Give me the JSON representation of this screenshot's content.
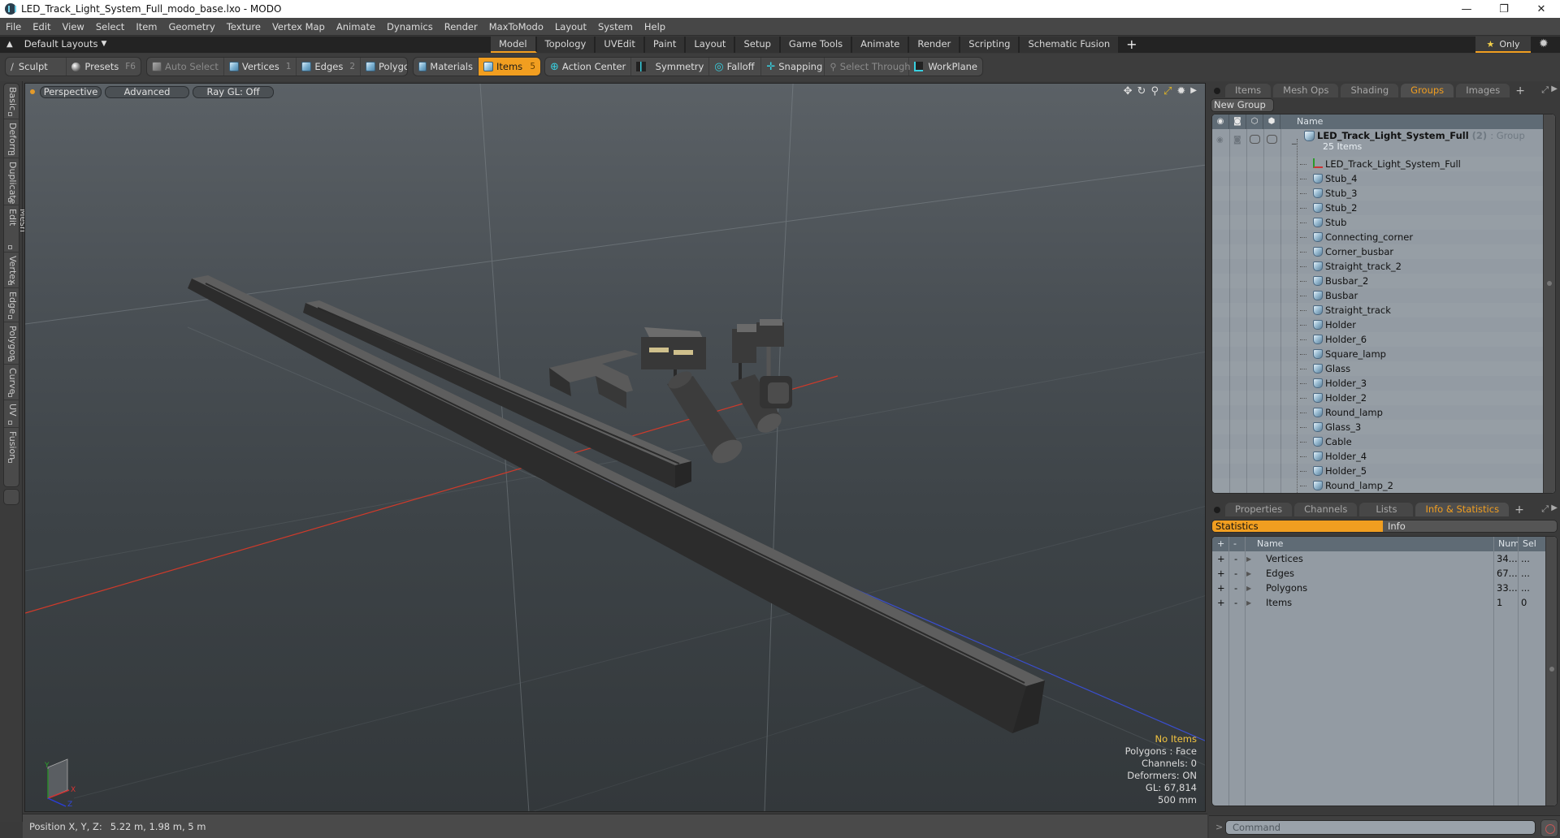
{
  "window": {
    "title": "LED_Track_Light_System_Full_modo_base.lxo - MODO",
    "controls": {
      "minimize": "—",
      "maximize": "❐",
      "close": "✕"
    }
  },
  "menu": [
    "File",
    "Edit",
    "View",
    "Select",
    "Item",
    "Geometry",
    "Texture",
    "Vertex Map",
    "Animate",
    "Dynamics",
    "Render",
    "MaxToModo",
    "Layout",
    "System",
    "Help"
  ],
  "layoutbar": {
    "layout_select": "Default Layouts",
    "tabs": [
      {
        "label": "Model",
        "active": true
      },
      {
        "label": "Topology"
      },
      {
        "label": "UVEdit"
      },
      {
        "label": "Paint"
      },
      {
        "label": "Layout"
      },
      {
        "label": "Setup"
      },
      {
        "label": "Game Tools"
      },
      {
        "label": "Animate"
      },
      {
        "label": "Render"
      },
      {
        "label": "Scripting"
      },
      {
        "label": "Schematic Fusion"
      }
    ],
    "add_tab": "+",
    "only_label": "Only"
  },
  "toolbar": {
    "sculpt": "Sculpt",
    "presets": "Presets",
    "presets_key": "F6",
    "auto_select": "Auto Select",
    "vertices": "Vertices",
    "vertices_key": "1",
    "edges": "Edges",
    "edges_key": "2",
    "polygons": "Polygons",
    "materials": "Materials",
    "items": "Items",
    "items_key": "5",
    "action_center": "Action Center",
    "symmetry": "Symmetry",
    "falloff": "Falloff",
    "snapping": "Snapping",
    "select_through": "Select Through",
    "workplane": "WorkPlane"
  },
  "left_tabs": [
    "Basic",
    "Deform",
    "Duplicate",
    "Mesh Edit",
    "Vertex",
    "Edge",
    "Polygon",
    "Curve",
    "UV",
    "Fusion"
  ],
  "viewport": {
    "view_mode": "Perspective",
    "shading": "Advanced",
    "raygl": "Ray GL: Off",
    "info": {
      "selection": "No Items",
      "polygons": "Polygons : Face",
      "channels": "Channels: 0",
      "deformers": "Deformers: ON",
      "gl": "GL: 67,814",
      "scale": "500 mm"
    },
    "axis_labels": {
      "x": "X",
      "y": "Y",
      "z": "Z"
    }
  },
  "status": {
    "position_label": "Position X, Y, Z:",
    "position_value": "5.22 m, 1.98 m, 5 m"
  },
  "groups_panel": {
    "tabs": [
      {
        "label": "Items"
      },
      {
        "label": "Mesh Ops"
      },
      {
        "label": "Shading"
      },
      {
        "label": "Groups",
        "active": true
      },
      {
        "label": "Images"
      }
    ],
    "new_group": "New Group",
    "column_name": "Name",
    "group": {
      "name": "LED_Track_Light_System_Full",
      "count": "(2)",
      "type": ": Group",
      "items_count": "25 Items"
    },
    "children": [
      {
        "name": "LED_Track_Light_System_Full",
        "icon": "locator-icon"
      },
      {
        "name": "Stub_4",
        "icon": "mesh-icon"
      },
      {
        "name": "Stub_3",
        "icon": "mesh-icon"
      },
      {
        "name": "Stub_2",
        "icon": "mesh-icon"
      },
      {
        "name": "Stub",
        "icon": "mesh-icon"
      },
      {
        "name": "Connecting_corner",
        "icon": "mesh-icon"
      },
      {
        "name": "Corner_busbar",
        "icon": "mesh-icon"
      },
      {
        "name": "Straight_track_2",
        "icon": "mesh-icon"
      },
      {
        "name": "Busbar_2",
        "icon": "mesh-icon"
      },
      {
        "name": "Busbar",
        "icon": "mesh-icon"
      },
      {
        "name": "Straight_track",
        "icon": "mesh-icon"
      },
      {
        "name": "Holder",
        "icon": "mesh-icon"
      },
      {
        "name": "Holder_6",
        "icon": "mesh-icon"
      },
      {
        "name": "Square_lamp",
        "icon": "mesh-icon"
      },
      {
        "name": "Glass",
        "icon": "mesh-icon"
      },
      {
        "name": "Holder_3",
        "icon": "mesh-icon"
      },
      {
        "name": "Holder_2",
        "icon": "mesh-icon"
      },
      {
        "name": "Round_lamp",
        "icon": "mesh-icon"
      },
      {
        "name": "Glass_3",
        "icon": "mesh-icon"
      },
      {
        "name": "Cable",
        "icon": "mesh-icon"
      },
      {
        "name": "Holder_4",
        "icon": "mesh-icon"
      },
      {
        "name": "Holder_5",
        "icon": "mesh-icon"
      },
      {
        "name": "Round_lamp_2",
        "icon": "mesh-icon"
      }
    ]
  },
  "info_panel": {
    "tabs": [
      {
        "label": "Properties"
      },
      {
        "label": "Channels"
      },
      {
        "label": "Lists"
      },
      {
        "label": "Info & Statistics",
        "active": true
      }
    ],
    "toggle": {
      "statistics": "Statistics",
      "info": "Info"
    },
    "columns": {
      "plus": "+",
      "minus": "-",
      "name": "Name",
      "num": "Num",
      "sel": "Sel"
    },
    "rows": [
      {
        "name": "Vertices",
        "num": "34...",
        "sel": "..."
      },
      {
        "name": "Edges",
        "num": "67...",
        "sel": "..."
      },
      {
        "name": "Polygons",
        "num": "33...",
        "sel": "..."
      },
      {
        "name": "Items",
        "num": "1",
        "sel": "0"
      }
    ]
  },
  "command": {
    "prompt": ">",
    "placeholder": "Command"
  },
  "colors": {
    "accent": "#f19e20",
    "viewport_bg_top": "#5b6166",
    "viewport_bg_bottom": "#33383b",
    "axis_x": "#d03a2a",
    "axis_z": "#3a4ed0",
    "info_highlight": "#f2c340"
  }
}
